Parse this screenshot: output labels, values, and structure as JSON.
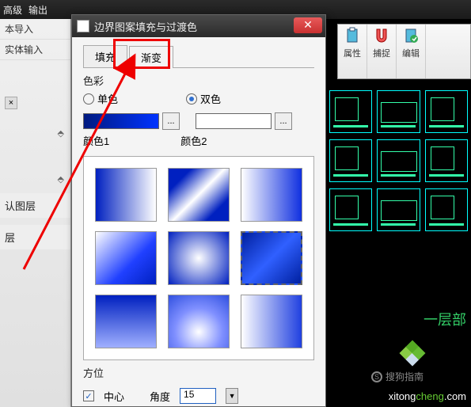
{
  "ribbon": {
    "menu1": "高级",
    "menu2": "输出"
  },
  "tools": {
    "t1": "属性",
    "t2": "捕捉",
    "t3": "编辑"
  },
  "left": {
    "i1": "本导入",
    "i2": "实体输入",
    "layer1": "认图层",
    "layer2": "层"
  },
  "dialog": {
    "title": "边界图案填充与过渡色",
    "tab_fill": "填充",
    "tab_gradient": "渐变",
    "section_color": "色彩",
    "radio_single": "单色",
    "radio_double": "双色",
    "swatch_btn": "...",
    "color1": "颜色1",
    "color2": "颜色2",
    "section_orient": "方位",
    "center": "中心",
    "angle_label": "角度",
    "angle_value": "15"
  },
  "canvas": {
    "floor": "一层部"
  },
  "watermark": {
    "w1": "搜狗指南",
    "w2a": "xitong",
    "w2b": "cheng",
    "w2c": ".com"
  }
}
